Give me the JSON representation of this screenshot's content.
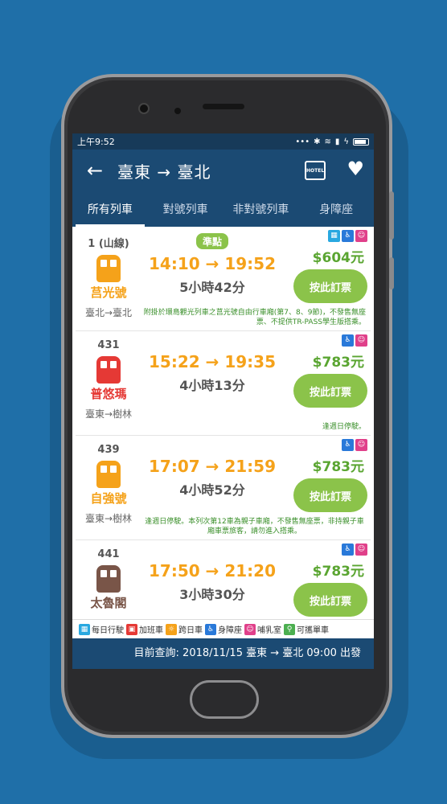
{
  "status": {
    "time": "上午9:52"
  },
  "appbar": {
    "title": "臺東 → 臺北",
    "hotel_label": "HOTEL"
  },
  "tabs": [
    "所有列車",
    "對號列車",
    "非對號列車",
    "身障座"
  ],
  "trains": [
    {
      "no": "1 (山線)",
      "name": "莒光號",
      "color": "#f5a21a",
      "direction": "臺北→臺北",
      "ontime": "準點",
      "times": "14:10 → 19:52",
      "duration": "5小時42分",
      "price": "$604元",
      "book": "按此訂票",
      "note": "附掛於環島觀光列車之莒光號自由行車廂(第7、8、9節)，不發售無座票、不提供TR-PASS學生版搭乘。"
    },
    {
      "no": "431",
      "name": "普悠瑪",
      "color": "#e53935",
      "direction": "臺東→樹林",
      "ontime": "",
      "times": "15:22 → 19:35",
      "duration": "4小時13分",
      "price": "$783元",
      "book": "按此訂票",
      "note": "逢週日停駛。"
    },
    {
      "no": "439",
      "name": "自強號",
      "color": "#f5a21a",
      "direction": "臺東→樹林",
      "ontime": "",
      "times": "17:07 → 21:59",
      "duration": "4小時52分",
      "price": "$783元",
      "book": "按此訂票",
      "note": "逢週日停駛。本列次第12車為親子車廂，不發售無座票，非持親子車廂車票旅客，請勿進入搭乘。"
    },
    {
      "no": "441",
      "name": "太魯閣",
      "color": "#795548",
      "direction": "",
      "ontime": "",
      "times": "17:50 → 21:20",
      "duration": "3小時30分",
      "price": "$783元",
      "book": "按此訂票",
      "note": ""
    }
  ],
  "legend": [
    "每日行駛",
    "加班車",
    "跨日車",
    "身障座",
    "哺乳室",
    "可攜單車"
  ],
  "footer": "目前查詢: 2018/11/15 臺東 → 臺北 09:00 出發"
}
